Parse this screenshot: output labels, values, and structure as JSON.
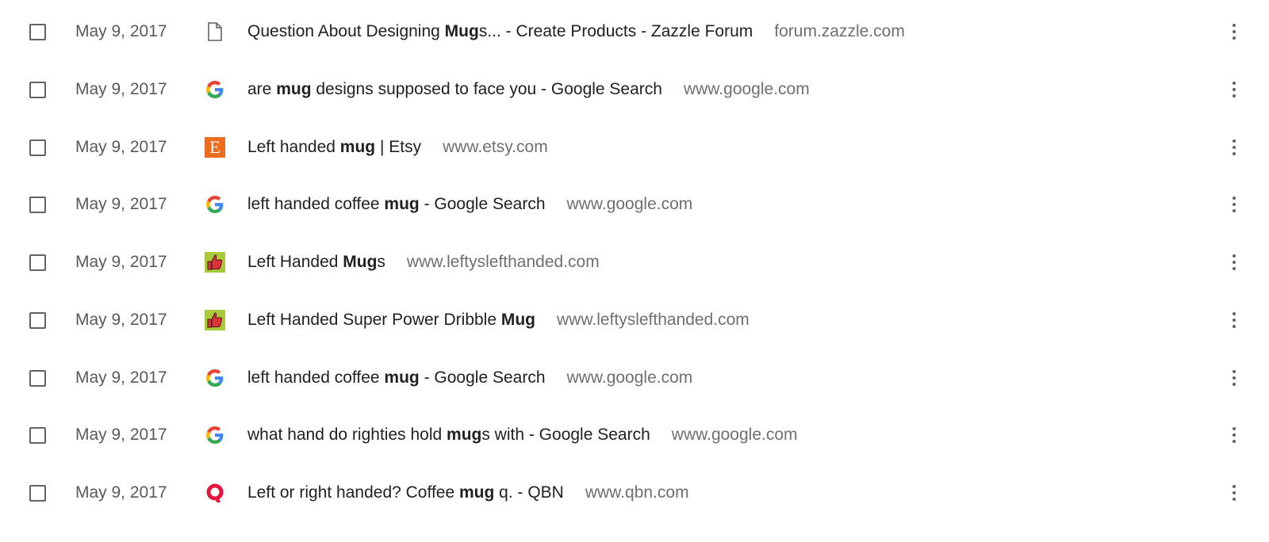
{
  "history": {
    "items": [
      {
        "date": "May 9, 2017",
        "favicon": "document-icon",
        "title_parts": [
          {
            "text": "Question About Designing ",
            "bold": false
          },
          {
            "text": "Mug",
            "bold": true
          },
          {
            "text": "s... - Create Products - Zazzle Forum",
            "bold": false
          }
        ],
        "domain": "forum.zazzle.com"
      },
      {
        "date": "May 9, 2017",
        "favicon": "google-icon",
        "title_parts": [
          {
            "text": "are ",
            "bold": false
          },
          {
            "text": "mug",
            "bold": true
          },
          {
            "text": " designs supposed to face you - Google Search",
            "bold": false
          }
        ],
        "domain": "www.google.com"
      },
      {
        "date": "May 9, 2017",
        "favicon": "etsy-icon",
        "title_parts": [
          {
            "text": "Left handed ",
            "bold": false
          },
          {
            "text": "mug",
            "bold": true
          },
          {
            "text": " | Etsy",
            "bold": false
          }
        ],
        "domain": "www.etsy.com"
      },
      {
        "date": "May 9, 2017",
        "favicon": "google-icon",
        "title_parts": [
          {
            "text": "left handed coffee ",
            "bold": false
          },
          {
            "text": "mug",
            "bold": true
          },
          {
            "text": " - Google Search",
            "bold": false
          }
        ],
        "domain": "www.google.com"
      },
      {
        "date": "May 9, 2017",
        "favicon": "thumbs-up-icon",
        "title_parts": [
          {
            "text": "Left Handed ",
            "bold": false
          },
          {
            "text": "Mug",
            "bold": true
          },
          {
            "text": "s",
            "bold": false
          }
        ],
        "domain": "www.leftyslefthanded.com"
      },
      {
        "date": "May 9, 2017",
        "favicon": "thumbs-up-icon",
        "title_parts": [
          {
            "text": "Left Handed Super Power Dribble ",
            "bold": false
          },
          {
            "text": "Mug",
            "bold": true
          }
        ],
        "domain": "www.leftyslefthanded.com"
      },
      {
        "date": "May 9, 2017",
        "favicon": "google-icon",
        "title_parts": [
          {
            "text": "left handed coffee ",
            "bold": false
          },
          {
            "text": "mug",
            "bold": true
          },
          {
            "text": " - Google Search",
            "bold": false
          }
        ],
        "domain": "www.google.com"
      },
      {
        "date": "May 9, 2017",
        "favicon": "google-icon",
        "title_parts": [
          {
            "text": "what hand do righties hold ",
            "bold": false
          },
          {
            "text": "mug",
            "bold": true
          },
          {
            "text": "s with - Google Search",
            "bold": false
          }
        ],
        "domain": "www.google.com"
      },
      {
        "date": "May 9, 2017",
        "favicon": "qbn-icon",
        "title_parts": [
          {
            "text": "Left or right handed? Coffee ",
            "bold": false
          },
          {
            "text": "mug",
            "bold": true
          },
          {
            "text": " q. - QBN",
            "bold": false
          }
        ],
        "domain": "www.qbn.com"
      }
    ]
  },
  "colors": {
    "date_text": "#5a5a5a",
    "title_text": "#212121",
    "domain_text": "#6f6f6f",
    "etsy_orange": "#eb6d20",
    "qbn_red": "#e5173f",
    "lefty_green": "#a8c93a"
  },
  "icons": {
    "etsy_letter": "E"
  }
}
